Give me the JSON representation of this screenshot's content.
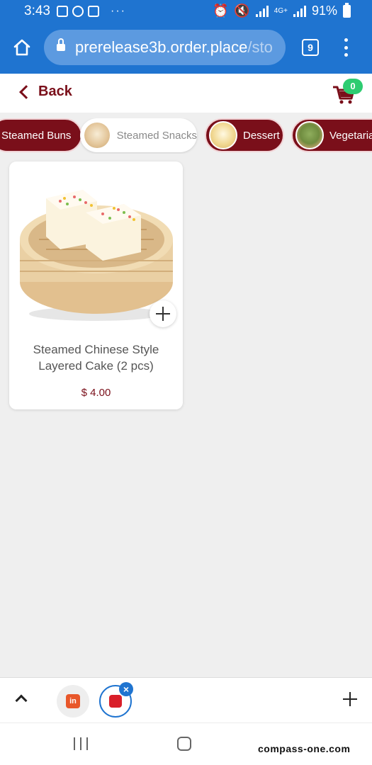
{
  "status_bar": {
    "time": "3:43",
    "battery": "91%",
    "network": "4G+",
    "notification_icons": [
      "gallery-icon",
      "whatsapp-icon",
      "calendar-icon"
    ],
    "more_indicator": "···"
  },
  "browser": {
    "url_host": "prerelease3b.order.place",
    "url_path": "/sto",
    "tab_count": "9"
  },
  "app_header": {
    "back_label": "Back",
    "cart_count": "0"
  },
  "categories": [
    {
      "label": "Steamed Buns",
      "selected": false
    },
    {
      "label": "Steamed Snacks",
      "selected": true
    },
    {
      "label": "Dessert",
      "selected": false
    },
    {
      "label": "Vegetarian",
      "selected": false
    }
  ],
  "products": [
    {
      "name": "Steamed Chinese Style Layered Cake (2 pcs)",
      "price": "$ 4.00"
    }
  ],
  "bottom_toolbar": {
    "tab1_logo": "in"
  },
  "watermark": "compass-one.com",
  "colors": {
    "brand_dark_red": "#7a0f1a",
    "browser_blue": "#1f74d0",
    "cart_badge_green": "#2ecc71",
    "background": "#efefef"
  }
}
